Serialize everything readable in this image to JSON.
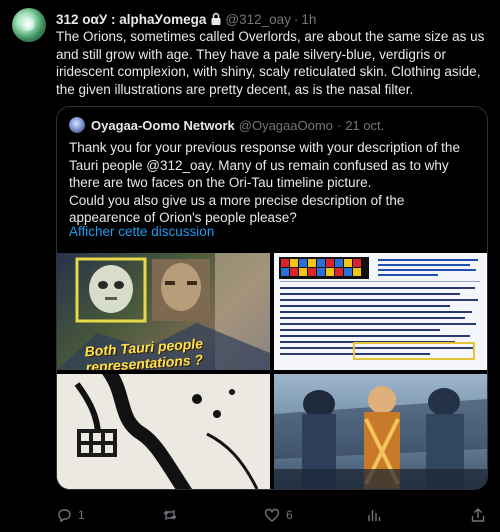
{
  "tweet": {
    "display_name": "312 oαУ : alphaУomega",
    "handle": "@312_oay",
    "separator": "·",
    "time": "1h",
    "text": "The Orions, sometimes called Overlords, are about the same size as us and still grow with age. They have a pale silvery-blue, verdigris or iridescent complexion, with shiny, scaly reticulated skin. Clothing aside, the given illustrations are pretty decent, as is the nasal filter."
  },
  "quote": {
    "display_name": "Oyagaa-Oomo Network",
    "handle": "@OyagaaOomo",
    "separator": "·",
    "date": "21 oct.",
    "text": "Thank you for your previous response with your description of the Tauri people @312_oay. Many of us remain confused as to why there are two faces on the Ori-Tau timeline picture.\nCould you also give us a more precise description of the appearence of Orion's people please?",
    "show_thread_link": "Afficher cette discussion",
    "media_caption": "Both Tauri people representations ?"
  },
  "actions": {
    "reply_count": "1",
    "retweet_count": "",
    "like_count": "6"
  },
  "icons": {
    "lock": "lock-icon",
    "reply": "reply-icon",
    "retweet": "retweet-icon",
    "like": "heart-icon",
    "views": "bar-chart-icon",
    "share": "share-icon"
  },
  "colors": {
    "background": "#000000",
    "text": "#e7e9ea",
    "secondary": "#71767b",
    "link": "#1d9bf0",
    "border": "#2f3336",
    "caption": "#ffe04a"
  }
}
